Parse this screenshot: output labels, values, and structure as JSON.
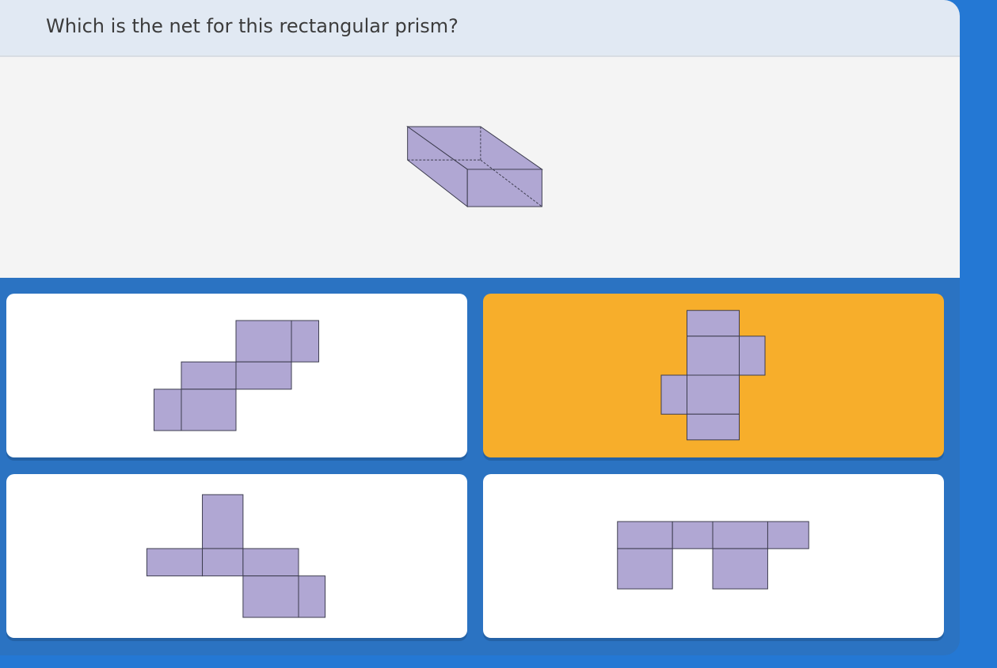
{
  "question": {
    "text": "Which is the net for this rectangular prism?"
  },
  "colors": {
    "page_background": "#2478d4",
    "answer_area": "#2b73c2",
    "header_background": "#e1e9f3",
    "figure_background": "#f4f4f4",
    "face_fill": "#b0a7d3",
    "face_stroke": "#3c3c4e",
    "card_background": "#ffffff",
    "selected_card_background": "#f7ae2b"
  },
  "options": [
    {
      "selected": false
    },
    {
      "selected": true
    },
    {
      "selected": false
    },
    {
      "selected": false
    }
  ]
}
